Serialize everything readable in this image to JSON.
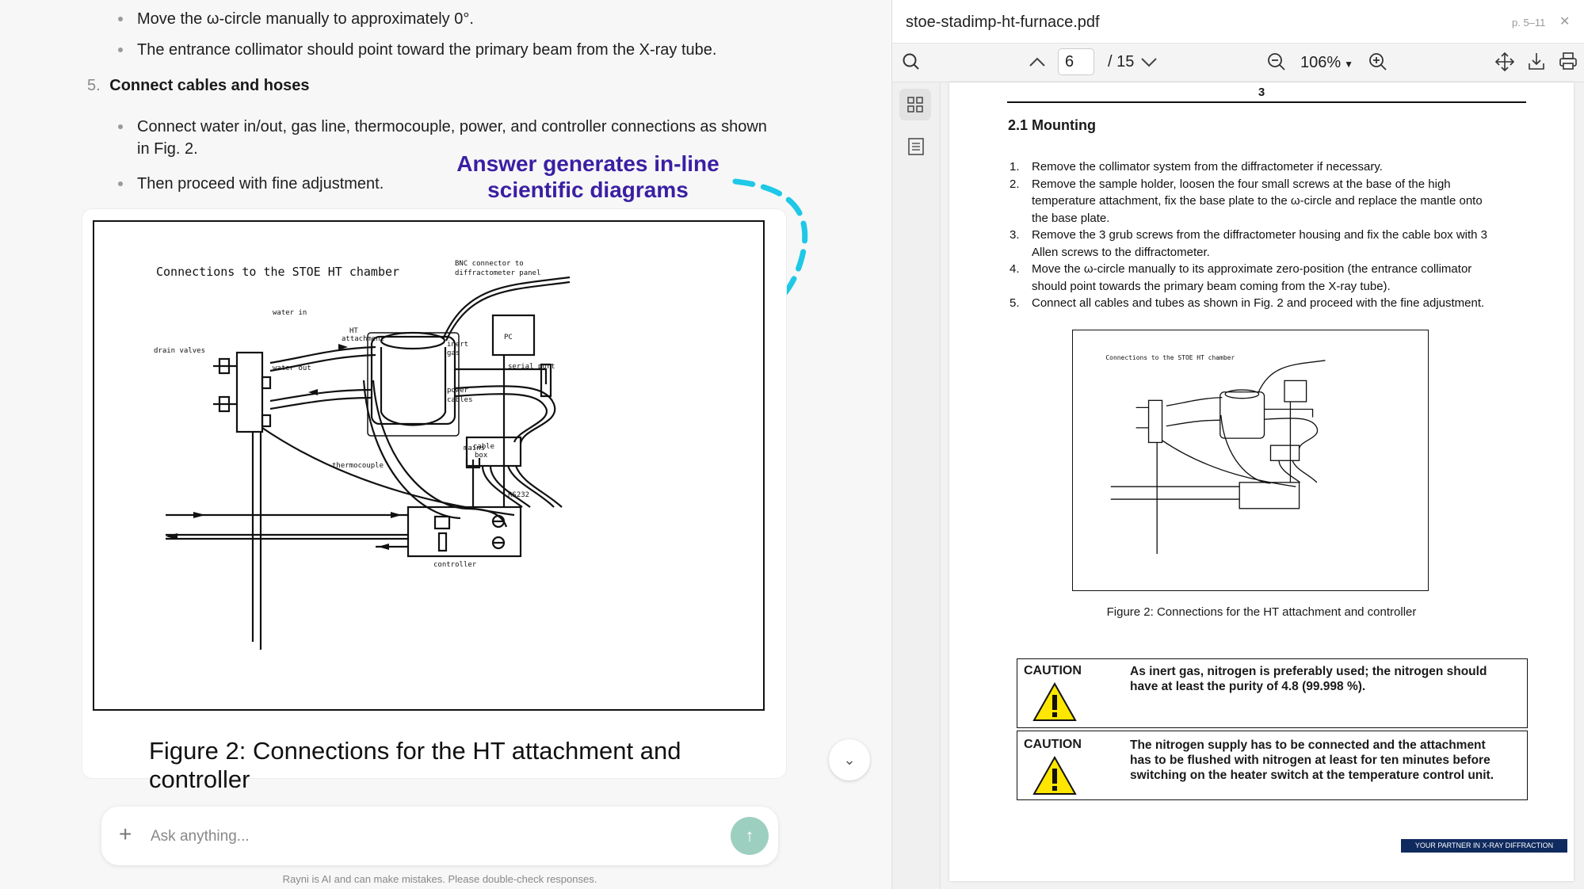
{
  "chat": {
    "bullets_top": [
      "Move the ω-circle manually to approximately 0°.",
      "The entrance collimator should point toward the primary beam from the X-ray tube."
    ],
    "step_number": "5.",
    "step_title": "Connect cables and hoses",
    "bullets_step": [
      "Connect water in/out, gas line, thermocouple, power, and controller connections as shown",
      "in Fig. 2.",
      "Then proceed with fine adjustment."
    ],
    "callout_line1": "Answer generates in-line",
    "callout_line2": "scientific diagrams",
    "figure_caption": "Figure 2: Connections for the HT attachment and controller",
    "composer_placeholder": "Ask anything...",
    "disclaimer": "Rayni is AI and can make mistakes. Please double-check responses."
  },
  "diagram": {
    "title": "Connections to the STOE HT chamber",
    "labels": {
      "bnc": "BNC connector to",
      "bnc2": "diffractometer panel",
      "water_in": "water in",
      "water_out": "water out",
      "drain": "drain valves",
      "ht": "HT",
      "ht2": "attachment",
      "inert": "inert",
      "gas": "gas",
      "pc": "PC",
      "serial": "serial port",
      "power": "power",
      "cables": "cables",
      "cable": "cable",
      "box": "box",
      "mains": "mains",
      "thermo": "thermocouple",
      "rs232": "RS232",
      "controller": "controller"
    }
  },
  "pdf": {
    "filename": "stoe-stadimp-ht-furnace.pdf",
    "page_ref": "p. 5–11",
    "current_page": "6",
    "total_pages": "/ 15",
    "zoom": "106%",
    "page_number": "3",
    "section": "2.1  Mounting",
    "steps": [
      {
        "n": "1.",
        "lines": [
          "Remove the collimator system from the diffractometer if necessary."
        ]
      },
      {
        "n": "2.",
        "lines": [
          "Remove the sample holder, loosen the four small screws at the base of the high",
          "temperature attachment, fix the base plate to the ω-circle and replace the mantle onto",
          "the base plate."
        ]
      },
      {
        "n": "3.",
        "lines": [
          "Remove the 3 grub screws from the diffractometer housing and fix the cable box with 3",
          "Allen screws to the diffractometer."
        ]
      },
      {
        "n": "4.",
        "lines": [
          "Move the ω-circle manually to its approximate zero-position (the entrance collimator",
          "should point towards the primary beam coming from the X-ray tube)."
        ]
      },
      {
        "n": "5.",
        "lines": [
          "Connect all cables and tubes as shown in Fig. 2 and proceed with the fine adjustment."
        ]
      }
    ],
    "figure_caption": "Figure 2: Connections for the HT attachment and controller",
    "cautions": [
      {
        "title": "CAUTION",
        "lines": [
          "As inert gas, nitrogen is preferably used; the nitrogen should",
          "have at least the purity of 4.8 (99.998 %)."
        ]
      },
      {
        "title": "CAUTION",
        "lines": [
          "The nitrogen supply has to be connected and the attachment",
          "has to be flushed with nitrogen at least for ten minutes before",
          "switching on the heater switch at the temperature control unit."
        ]
      }
    ],
    "footer_banner": "YOUR PARTNER IN X-RAY DIFFRACTION"
  }
}
